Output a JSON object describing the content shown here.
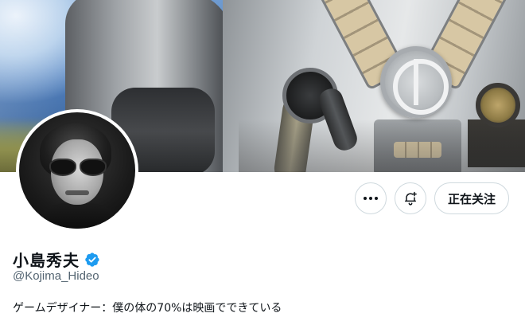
{
  "profile": {
    "display_name": "小島秀夫",
    "handle": "@Kojima_Hideo",
    "bio": "ゲームデザイナー：僕の体の70%は映画でできている",
    "verified": true
  },
  "actions": {
    "more_icon": "more-horizontal-icon",
    "notify_icon": "bell-plus-icon",
    "follow_label": "正在关注"
  },
  "colors": {
    "verified_blue": "#1d9bf0",
    "text_primary": "#0f1419",
    "text_secondary": "#536471",
    "border": "#cfd9de"
  }
}
